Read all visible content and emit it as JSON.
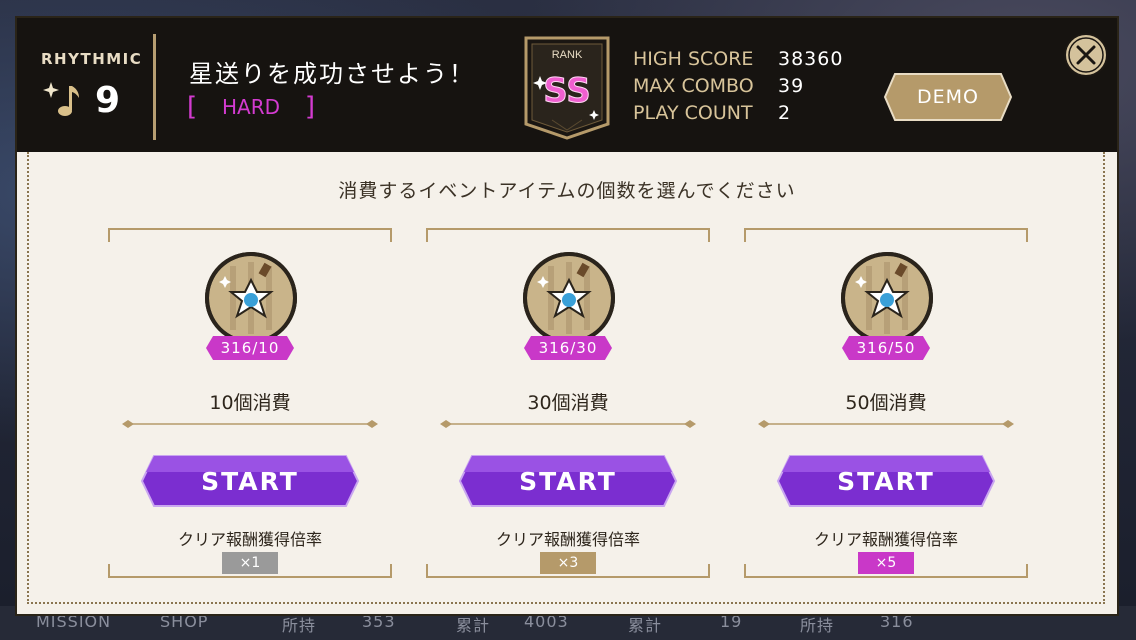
{
  "header": {
    "mode_label": "RHYTHMIC",
    "level": "9",
    "song_title": "星送りを成功させよう！",
    "difficulty": "HARD",
    "rank_label": "RANK",
    "rank": "SS",
    "stats": [
      {
        "label": "HIGH SCORE",
        "value": "38360"
      },
      {
        "label": "MAX COMBO",
        "value": "39"
      },
      {
        "label": "PLAY COUNT",
        "value": "2"
      }
    ],
    "demo_label": "DEMO"
  },
  "instruction": "消費するイベントアイテムの個数を選んでください",
  "options": [
    {
      "count": "316/10",
      "consume": "10個消費",
      "start": "START",
      "reward_label": "クリア報酬獲得倍率",
      "multiplier": "×1",
      "mult_color": "#9a9a9a"
    },
    {
      "count": "316/30",
      "consume": "30個消費",
      "start": "START",
      "reward_label": "クリア報酬獲得倍率",
      "multiplier": "×3",
      "mult_color": "#b59a6a"
    },
    {
      "count": "316/50",
      "consume": "50個消費",
      "start": "START",
      "reward_label": "クリア報酬獲得倍率",
      "multiplier": "×5",
      "mult_color": "#c938c8"
    }
  ],
  "bottom_bar": {
    "mission": "MISSION",
    "shop": "SHOP",
    "owned_label_1": "所持",
    "owned_value_1": "353",
    "total_label_1": "累計",
    "total_value_1": "4003",
    "total_label_2": "累計",
    "total_value_2": "19",
    "owned_label_2": "所持",
    "owned_value_2": "316"
  },
  "colors": {
    "accent_purple": "#7b2ed0",
    "accent_pink": "#c938c8",
    "gold": "#b59a6a"
  }
}
